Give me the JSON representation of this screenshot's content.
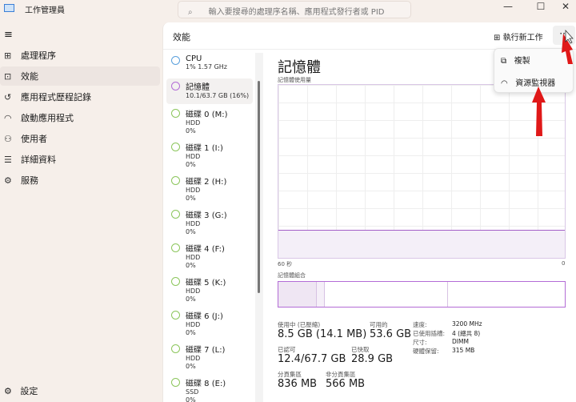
{
  "app": {
    "title": "工作管理員",
    "search_placeholder": "輸入要搜尋的處理序名稱、應用程式發行者或 PID"
  },
  "window_controls": {
    "minimize": "—",
    "maximize": "☐",
    "close": "✕"
  },
  "sidebar": {
    "items": [
      {
        "label": "處理程序",
        "icon": "processes-icon"
      },
      {
        "label": "效能",
        "icon": "performance-icon"
      },
      {
        "label": "應用程式歷程記錄",
        "icon": "history-icon"
      },
      {
        "label": "啟動應用程式",
        "icon": "startup-icon"
      },
      {
        "label": "使用者",
        "icon": "users-icon"
      },
      {
        "label": "詳細資料",
        "icon": "details-icon"
      },
      {
        "label": "服務",
        "icon": "services-icon"
      }
    ],
    "settings": "設定"
  },
  "header": {
    "title": "效能",
    "run_new_task": "執行新工作",
    "more": "···"
  },
  "menu": {
    "copy": "複製",
    "resource_monitor": "資源監視器"
  },
  "devices": [
    {
      "name": "CPU",
      "l1": "1% 1.57 GHz",
      "l2": "",
      "color": "#5aa0dc"
    },
    {
      "name": "記憶體",
      "l1": "10.1/63.7 GB (16%)",
      "l2": "",
      "color": "#b36cd6"
    },
    {
      "name": "磁碟 0 (M:)",
      "l1": "HDD",
      "l2": "0%",
      "color": "#8cc65c"
    },
    {
      "name": "磁碟 1 (I:)",
      "l1": "HDD",
      "l2": "0%",
      "color": "#8cc65c"
    },
    {
      "name": "磁碟 2 (H:)",
      "l1": "HDD",
      "l2": "0%",
      "color": "#8cc65c"
    },
    {
      "name": "磁碟 3 (G:)",
      "l1": "HDD",
      "l2": "0%",
      "color": "#8cc65c"
    },
    {
      "name": "磁碟 4 (F:)",
      "l1": "HDD",
      "l2": "0%",
      "color": "#8cc65c"
    },
    {
      "name": "磁碟 5 (K:)",
      "l1": "HDD",
      "l2": "0%",
      "color": "#8cc65c"
    },
    {
      "name": "磁碟 6 (J:)",
      "l1": "HDD",
      "l2": "0%",
      "color": "#8cc65c"
    },
    {
      "name": "磁碟 7 (L:)",
      "l1": "HDD",
      "l2": "0%",
      "color": "#8cc65c"
    },
    {
      "name": "磁碟 8 (E:)",
      "l1": "SSD",
      "l2": "0%",
      "color": "#8cc65c"
    }
  ],
  "detail": {
    "title": "記憶體",
    "graph_label": "記憶體使用量",
    "time_left": "60 秒",
    "time_right": "0",
    "composition_label": "記憶體組合",
    "usage_percent": 16,
    "stats": {
      "in_use_label": "使用中 (已壓縮)",
      "in_use": "8.5 GB (14.1 MB)",
      "available_label": "可用的",
      "available": "53.6 GB",
      "committed_label": "已認可",
      "committed": "12.4/67.7 GB",
      "cached_label": "已快取",
      "cached": "28.9 GB",
      "paged_label": "分頁集區",
      "paged": "836 MB",
      "nonpaged_label": "非分頁集區",
      "nonpaged": "566 MB"
    },
    "specs": [
      {
        "k": "速度:",
        "v": "3200 MHz"
      },
      {
        "k": "已使用插槽:",
        "v": "4 (總共 8)"
      },
      {
        "k": "尺寸:",
        "v": "DIMM"
      },
      {
        "k": "硬體保留:",
        "v": "315 MB"
      }
    ]
  }
}
